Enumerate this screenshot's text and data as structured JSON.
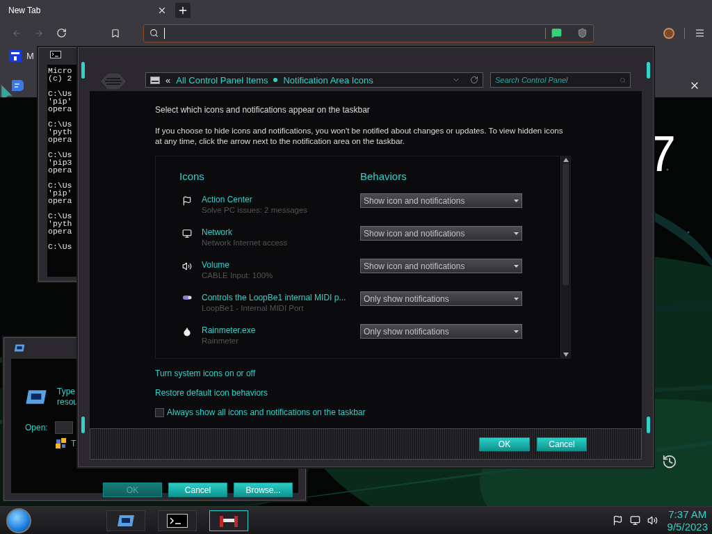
{
  "browser": {
    "tab": {
      "title": "New Tab",
      "selected": true
    },
    "bookmark": {
      "label": "M"
    },
    "new_tab_page": {
      "clock": "7"
    }
  },
  "cmd_window": {
    "blocks": [
      [
        "Micro",
        "(c) 2"
      ],
      [
        "C:\\Us",
        "'pip'",
        "opera"
      ],
      [
        "C:\\Us",
        "'pyth",
        "opera"
      ],
      [
        "C:\\Us",
        "'pip3",
        "opera"
      ],
      [
        "C:\\Us",
        "'pip'",
        "opera"
      ],
      [
        "C:\\Us",
        "'pyth",
        "opera"
      ],
      [
        "C:\\Us"
      ]
    ]
  },
  "run_dialog": {
    "prompt_lines": [
      "Type",
      "resou"
    ],
    "open_label": "Open:",
    "hint": "T",
    "buttons": [
      {
        "label": "OK",
        "disabled": true
      },
      {
        "label": "Cancel",
        "disabled": false
      },
      {
        "label": "Browse...",
        "disabled": false
      }
    ]
  },
  "control_panel": {
    "back_label": "«",
    "breadcrumb": [
      "All Control Panel Items",
      "Notification Area Icons"
    ],
    "search": {
      "placeholder": "Search Control Panel"
    },
    "heading": "Select which icons and notifications appear on the taskbar",
    "description": "If you choose to hide icons and notifications, you won't be notified about changes or updates. To view hidden icons at any time, click the arrow next to the notification area on the taskbar.",
    "columns": [
      "Icons",
      "Behaviors"
    ],
    "rows": [
      {
        "kind": "flag",
        "name": "Action Center",
        "detail": "Solve PC issues: 2 messages",
        "behavior": "Show icon and notifications"
      },
      {
        "kind": "network",
        "name": "Network",
        "detail": "Network Internet access",
        "behavior": "Show icon and notifications"
      },
      {
        "kind": "volume",
        "name": "Volume",
        "detail": "CABLE Input: 100%",
        "behavior": "Show icon and notifications"
      },
      {
        "kind": "midi",
        "name": "Controls the LoopBe1 internal MIDI p...",
        "detail": "LoopBe1 - Internal MIDI Port",
        "behavior": "Only show notifications"
      },
      {
        "kind": "drop",
        "name": "Rainmeter.exe",
        "detail": "Rainmeter",
        "behavior": "Only show notifications"
      }
    ],
    "links": [
      "Turn system icons on or off",
      "Restore default icon behaviors"
    ],
    "always_show": {
      "label": "Always show all icons and notifications on the taskbar",
      "checked": false
    },
    "buttons": [
      "OK",
      "Cancel"
    ]
  },
  "taskbar": {
    "tasks": [
      {
        "kind": "run",
        "selected": false
      },
      {
        "kind": "console",
        "selected": false
      },
      {
        "kind": "game",
        "selected": true
      }
    ],
    "time": "7:37 AM",
    "date": "9/5/2023"
  }
}
